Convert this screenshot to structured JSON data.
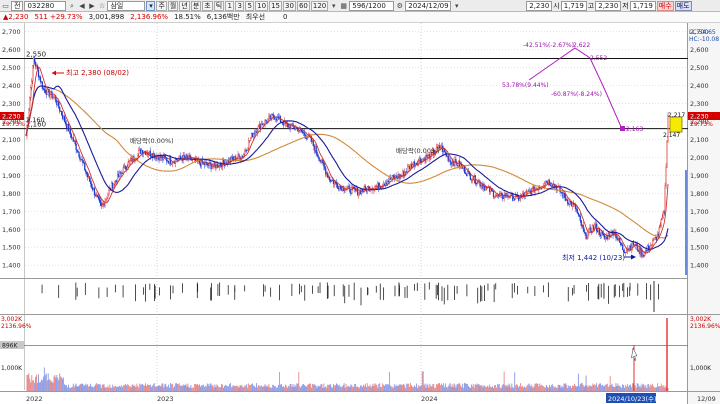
{
  "toolbar": {
    "market_label": "전",
    "code": "032280",
    "name": "삼일",
    "periods": [
      "주",
      "월",
      "년",
      "분",
      "초",
      "틱"
    ],
    "minutes": [
      "1",
      "3",
      "5",
      "10",
      "15",
      "30",
      "60",
      "120"
    ],
    "count": "596/1200",
    "date": "2024/12/09",
    "price_fields": [
      {
        "label": "",
        "value": "2,230"
      },
      {
        "label": "시",
        "value": "1,719"
      },
      {
        "label": "고",
        "value": "2,230"
      },
      {
        "label": "저",
        "value": "1,719"
      }
    ],
    "buy_label": "매수",
    "sell_label": "매도"
  },
  "info": {
    "price": "2,230",
    "change": "511 +29.73%",
    "volume": "3,001,898",
    "turnover": "2,136.96%",
    "ratio": "18.51%",
    "prev_volume": "6,136백만",
    "pref_label": "최우선",
    "pref_value": "0"
  },
  "chart_data": {
    "type": "candlestick",
    "x_labels": [
      "2022",
      "2023",
      "2024",
      "12/09"
    ],
    "y_ticks": [
      2700,
      2600,
      2500,
      2400,
      2300,
      2200,
      2100,
      2000,
      1900,
      1800,
      1700,
      1600,
      1500,
      1400
    ],
    "y_tick_labels": [
      "2,700",
      "2,600",
      "2,500",
      "2,400",
      "2,300",
      "2,200",
      "2,100",
      "2,000",
      "1,900",
      "1,800",
      "1,700",
      "1,600",
      "1,500",
      "1,400"
    ],
    "ylim": [
      1340,
      2720
    ],
    "hlines": [
      {
        "value": 2550,
        "label": "2,550"
      },
      {
        "value": 2160,
        "label": "2,160"
      }
    ],
    "right_labels": {
      "lc": "LC:54.65",
      "hc": "HC:-10.08",
      "cur": "2,230",
      "pct": "29.73%",
      "level": "2,160"
    },
    "annotations": {
      "high": "최고 2,380 (08/02)",
      "low": "최저 1,442 (10/23)",
      "div1": "배당락(0.00%)",
      "div2": "배당락(0.00%)",
      "label_2160": "2,160",
      "zig_a": "-42.51%(-2.67%)",
      "zig_b": "2,622",
      "zig_c": "2,552",
      "zig_d": "53.78%(9.44%)",
      "zig_e": "-60.87%(-8.24%)",
      "zig_f": "2,163",
      "last_high": "2,217",
      "last_low": "2,147"
    },
    "volume": {
      "ticks": [
        "3,002K",
        "1,000K",
        "896K"
      ],
      "pct": "2136.96%",
      "last_date": "2024/10/23(수)"
    },
    "close_key": [
      [
        0,
        2120
      ],
      [
        8,
        2550
      ],
      [
        18,
        2380
      ],
      [
        30,
        2330
      ],
      [
        42,
        2180
      ],
      [
        55,
        2020
      ],
      [
        65,
        1880
      ],
      [
        78,
        1720
      ],
      [
        90,
        1850
      ],
      [
        105,
        1960
      ],
      [
        120,
        2040
      ],
      [
        135,
        2010
      ],
      [
        150,
        1980
      ],
      [
        165,
        2000
      ],
      [
        180,
        1970
      ],
      [
        195,
        1950
      ],
      [
        210,
        1980
      ],
      [
        225,
        2010
      ],
      [
        235,
        2130
      ],
      [
        245,
        2190
      ],
      [
        258,
        2230
      ],
      [
        270,
        2180
      ],
      [
        282,
        2160
      ],
      [
        295,
        2100
      ],
      [
        305,
        1990
      ],
      [
        315,
        1880
      ],
      [
        325,
        1840
      ],
      [
        335,
        1820
      ],
      [
        345,
        1810
      ],
      [
        355,
        1830
      ],
      [
        365,
        1840
      ],
      [
        378,
        1880
      ],
      [
        390,
        1900
      ],
      [
        400,
        1960
      ],
      [
        410,
        1990
      ],
      [
        420,
        2010
      ],
      [
        430,
        2060
      ],
      [
        440,
        1980
      ],
      [
        450,
        1960
      ],
      [
        460,
        1900
      ],
      [
        470,
        1860
      ],
      [
        480,
        1820
      ],
      [
        490,
        1780
      ],
      [
        500,
        1790
      ],
      [
        510,
        1770
      ],
      [
        520,
        1800
      ],
      [
        530,
        1830
      ],
      [
        540,
        1870
      ],
      [
        550,
        1840
      ],
      [
        560,
        1770
      ],
      [
        570,
        1720
      ],
      [
        580,
        1560
      ],
      [
        590,
        1620
      ],
      [
        600,
        1550
      ],
      [
        610,
        1590
      ],
      [
        620,
        1480
      ],
      [
        630,
        1520
      ],
      [
        640,
        1460
      ],
      [
        648,
        1510
      ],
      [
        656,
        1570
      ],
      [
        662,
        1700
      ],
      [
        666,
        2230
      ]
    ]
  }
}
